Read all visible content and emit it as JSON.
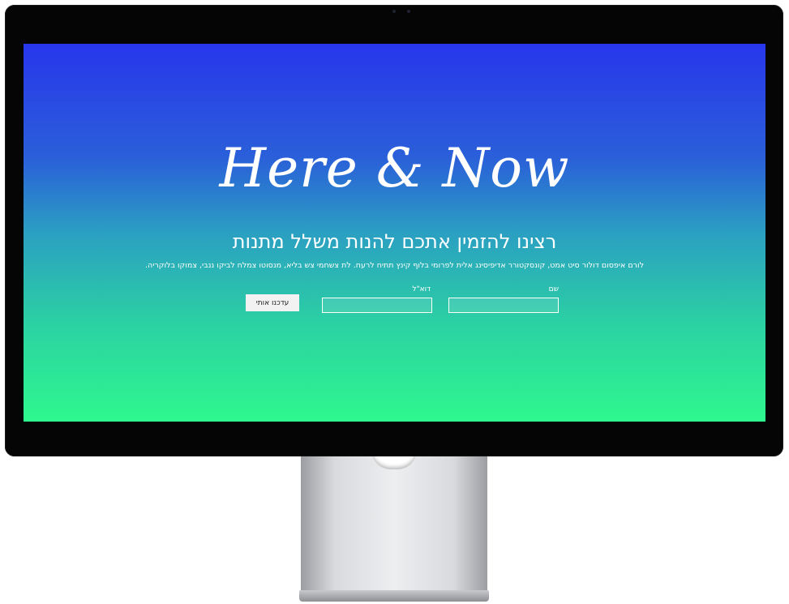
{
  "hero": {
    "title": "Here & Now",
    "subtitle": "רצינו להזמין אתכם להנות משלל מתנות",
    "description": "לורם איפסום דולור סיט אמט, קונסקטורר אדיפיסינג אלית לפרומי בלוף קינץ תתיח לרעח. לת צשחמי צש בליא, מנסוטו צמלח לביקו ננבי, צמוקו בלוקריה."
  },
  "form": {
    "name_label": "שם",
    "name_value": "",
    "email_label": "דוא\"ל",
    "email_value": "",
    "submit_label": "עדכנו אותי"
  },
  "colors": {
    "gradient_top": "#2836ec",
    "gradient_bottom": "#2ef88e",
    "text": "#ffffff"
  }
}
